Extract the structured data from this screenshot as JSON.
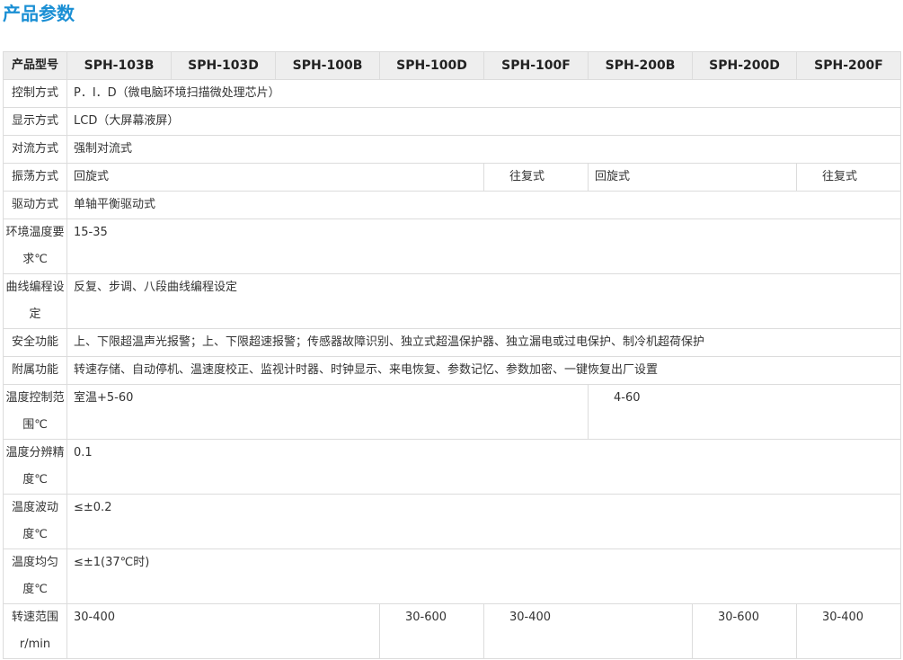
{
  "heading": "产品参数",
  "header": {
    "label": "产品型号",
    "models": [
      "SPH-103B",
      "SPH-103D",
      "SPH-100B",
      "SPH-100D",
      "SPH-100F",
      "SPH-200B",
      "SPH-200D",
      "SPH-200F"
    ]
  },
  "rows": {
    "control": {
      "label": "控制方式",
      "value": "P．I．D（微电脑环境扫描微处理芯片）"
    },
    "display": {
      "label": "显示方式",
      "value": "LCD（大屏幕液屏）"
    },
    "convection": {
      "label": "对流方式",
      "value": "强制对流式"
    },
    "oscillation": {
      "label": "振荡方式",
      "v1": "回旋式",
      "v2": "往复式",
      "v3": "回旋式",
      "v4": "往复式"
    },
    "drive": {
      "label": "驱动方式",
      "value": "单轴平衡驱动式"
    },
    "ambient": {
      "label": "环境温度要求℃",
      "value": "15-35"
    },
    "curve": {
      "label": "曲线编程设定",
      "value": "反复、步调、八段曲线编程设定"
    },
    "safety": {
      "label": "安全功能",
      "value": "上、下限超温声光报警；上、下限超速报警；传感器故障识别、独立式超温保护器、独立漏电或过电保护、制冷机超荷保护"
    },
    "accessory": {
      "label": "附属功能",
      "value": "转速存储、自动停机、温速度校正、监视计时器、时钟显示、来电恢复、参数记忆、参数加密、一键恢复出厂设置"
    },
    "temp_range": {
      "label": "温度控制范围℃",
      "v1": "室温+5-60",
      "v2": "4-60"
    },
    "resolution": {
      "label": "温度分辨精度℃",
      "value": "0.1"
    },
    "fluctuation": {
      "label": "温度波动度℃",
      "value": "≤±0.2"
    },
    "uniformity": {
      "label": "温度均匀度℃",
      "value": "≤±1(37℃时)"
    },
    "speed": {
      "label": "转速范围r/min",
      "v1": "30-400",
      "v2": "30-600",
      "v3": "30-400",
      "v4": "30-600",
      "v5": "30-400"
    }
  }
}
